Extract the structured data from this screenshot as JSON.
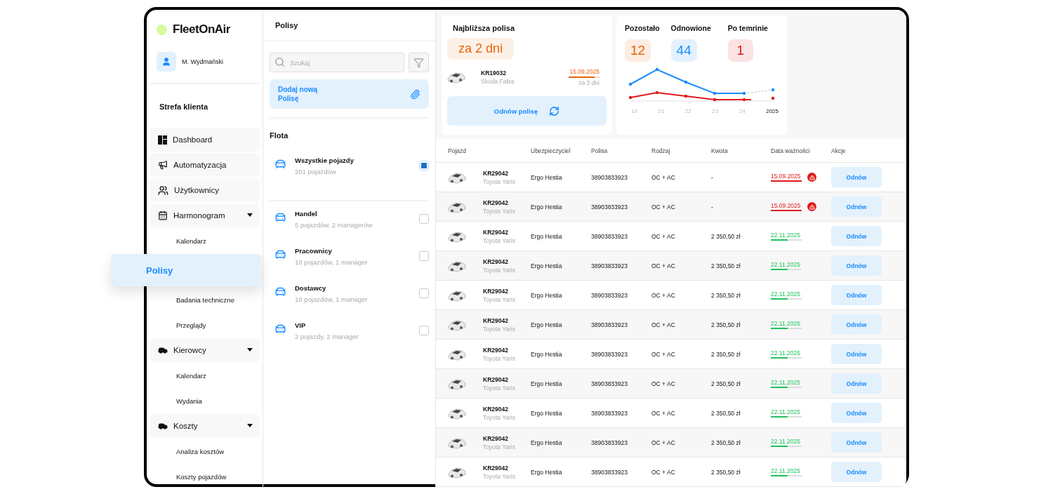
{
  "brand": {
    "name": "FleetOnAir"
  },
  "user": {
    "name": "M. Wydmański"
  },
  "sidebar": {
    "section": "Strefa klienta",
    "items": [
      {
        "kind": "main",
        "label": "Dashboard"
      },
      {
        "kind": "main",
        "label": "Automatyzacja"
      },
      {
        "kind": "main",
        "label": "Użytkownicy"
      },
      {
        "kind": "main",
        "label": "Harmonogram",
        "expanded": true
      },
      {
        "kind": "sub",
        "label": "Kalendarz",
        "selected": false
      },
      {
        "kind": "sub",
        "label": "Polisy",
        "selected": true
      },
      {
        "kind": "sub",
        "label": "Badania techniczne",
        "selected": false
      },
      {
        "kind": "sub",
        "label": "Przeglądy",
        "selected": false
      },
      {
        "kind": "main",
        "label": "Kierowcy",
        "expanded": true
      },
      {
        "kind": "sub",
        "label": "Kalendarz",
        "selected": false
      },
      {
        "kind": "sub",
        "label": "Wydania",
        "selected": false
      },
      {
        "kind": "main",
        "label": "Koszty",
        "expanded": true
      },
      {
        "kind": "sub",
        "label": "Analiza kosztów",
        "selected": false
      },
      {
        "kind": "sub",
        "label": "Koszty pojazdów",
        "selected": false
      }
    ]
  },
  "panel": {
    "title": "Polisy",
    "search": {
      "placeholder": "Szukaj"
    },
    "add_button": "Dodaj nową Polisę",
    "fleet_title": "Flota",
    "groups": [
      {
        "name": "Wszystkie pojazdy",
        "info": "201 pojazdów",
        "checked": true
      },
      {
        "name": "Handel",
        "info": "5 pojazdów, 2 managerów",
        "checked": false
      },
      {
        "name": "Pracownicy",
        "info": "10 pojazdów, 1 manager",
        "checked": false
      },
      {
        "name": "Dostawcy",
        "info": "10 pojazdów, 1 manager",
        "checked": false
      },
      {
        "name": "VIP",
        "info": "2 pojazdy, 2 manager",
        "checked": false
      }
    ]
  },
  "nearest": {
    "title": "Najbliższa polisa",
    "badge": "za 2 dni",
    "plate": "KR19032",
    "model": "Skoda Fabia",
    "date": "15.09.2025",
    "level": 0.85,
    "remaining": "za 3 dni",
    "button": "Odnów polisę"
  },
  "stats": [
    {
      "label": "Pozostało",
      "value": "12",
      "color": "#e8650a"
    },
    {
      "label": "Odnowione",
      "value": "44",
      "color": "#1a8cff"
    },
    {
      "label": "Po temrinie",
      "value": "1",
      "color": "#e01b1b"
    }
  ],
  "trend": {
    "x_labels": [
      "10",
      "21",
      "22",
      "23",
      "24",
      "2025"
    ]
  },
  "table": {
    "columns": [
      "Pojazd",
      "Ubezpieczyciel",
      "Polisa",
      "Rodzaj",
      "Kwota",
      "Data ważności",
      "Akcje"
    ],
    "rows": [
      {
        "plate": "KR29042",
        "model": "Toyota Yaris",
        "insurer": "Ergo Hestia",
        "policy": "38903833923",
        "type": "OC + AC",
        "amount": "-",
        "date": "15.09.2025",
        "kind": "overdue",
        "level": 1,
        "action": "Odnów"
      },
      {
        "plate": "KR29042",
        "model": "Toyota Yaris",
        "insurer": "Ergo Hestia",
        "policy": "38903833923",
        "type": "OC + AC",
        "amount": "-",
        "date": "15.09.2025",
        "kind": "overdue",
        "level": 1,
        "action": "Odnów"
      },
      {
        "plate": "KR29042",
        "model": "Toyota Yaris",
        "insurer": "Ergo Hestia",
        "policy": "38903833923",
        "type": "OC + AC",
        "amount": "2 350,50 zł",
        "date": "22.11.2025",
        "kind": "ok",
        "level": 0.55,
        "action": "Odnów"
      },
      {
        "plate": "KR29042",
        "model": "Toyota Yaris",
        "insurer": "Ergo Hestia",
        "policy": "38903833923",
        "type": "OC + AC",
        "amount": "2 350,50 zł",
        "date": "22.11.2025",
        "kind": "ok",
        "level": 0.55,
        "action": "Odnów"
      },
      {
        "plate": "KR29042",
        "model": "Toyota Yaris",
        "insurer": "Ergo Hestia",
        "policy": "38903833923",
        "type": "OC + AC",
        "amount": "2 350,50 zł",
        "date": "22.11.2025",
        "kind": "ok",
        "level": 0.55,
        "action": "Odnów"
      },
      {
        "plate": "KR29042",
        "model": "Toyota Yaris",
        "insurer": "Ergo Hestia",
        "policy": "38903833923",
        "type": "OC + AC",
        "amount": "2 350,50 zł",
        "date": "22.11.2025",
        "kind": "ok",
        "level": 0.55,
        "action": "Odnów"
      },
      {
        "plate": "KR29042",
        "model": "Toyota Yaris",
        "insurer": "Ergo Hestia",
        "policy": "38903833923",
        "type": "OC + AC",
        "amount": "2 350,50 zł",
        "date": "22.11.2025",
        "kind": "ok",
        "level": 0.55,
        "action": "Odnów"
      },
      {
        "plate": "KR29042",
        "model": "Toyota Yaris",
        "insurer": "Ergo Hestia",
        "policy": "38903833923",
        "type": "OC + AC",
        "amount": "2 350,50 zł",
        "date": "22.11.2025",
        "kind": "ok",
        "level": 0.55,
        "action": "Odnów"
      },
      {
        "plate": "KR29042",
        "model": "Toyota Yaris",
        "insurer": "Ergo Hestia",
        "policy": "38903833923",
        "type": "OC + AC",
        "amount": "2 350,50 zł",
        "date": "22.11.2025",
        "kind": "ok",
        "level": 0.55,
        "action": "Odnów"
      },
      {
        "plate": "KR29042",
        "model": "Toyota Yaris",
        "insurer": "Ergo Hestia",
        "policy": "38903833923",
        "type": "OC + AC",
        "amount": "2 350,50 zł",
        "date": "22.11.2025",
        "kind": "ok",
        "level": 0.55,
        "action": "Odnów"
      },
      {
        "plate": "KR29042",
        "model": "Toyota Yaris",
        "insurer": "Ergo Hestia",
        "policy": "38903833923",
        "type": "OC + AC",
        "amount": "2 350,50 zł",
        "date": "22.11.2025",
        "kind": "ok",
        "level": 0.55,
        "action": "Odnów"
      }
    ]
  }
}
